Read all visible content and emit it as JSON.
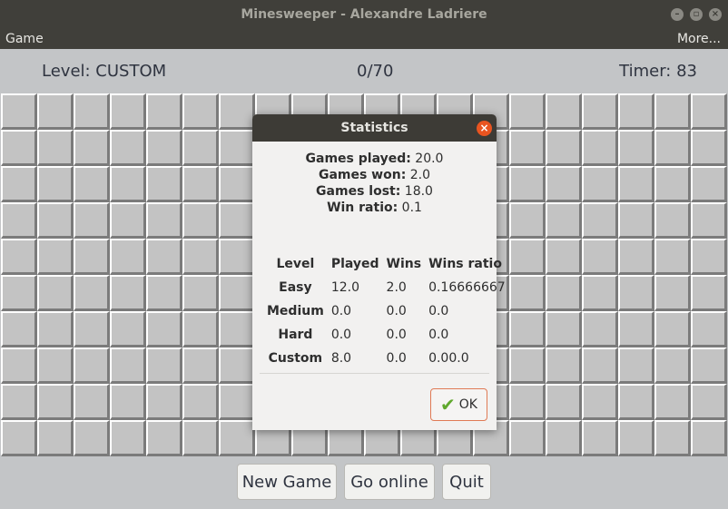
{
  "window": {
    "title": "Minesweeper - Alexandre Ladriere"
  },
  "menu": {
    "game": "Game",
    "more": "More..."
  },
  "status": {
    "level": "Level: CUSTOM",
    "progress": "0/70",
    "timer": "Timer: 83"
  },
  "buttons": {
    "new_game": "New Game",
    "go_online": "Go online",
    "quit": "Quit"
  },
  "icons": {
    "close": "close-icon",
    "minimize": "minimize-icon",
    "maximize": "maximize-icon",
    "check": "check-icon"
  },
  "colors": {
    "accent": "#e95420",
    "titlebar": "#403f3a",
    "board": "#c3c5c7"
  },
  "dialog": {
    "title": "Statistics",
    "summary": [
      {
        "label": "Games played:",
        "value": "20.0"
      },
      {
        "label": "Games won:",
        "value": "2.0"
      },
      {
        "label": "Games lost:",
        "value": "18.0"
      },
      {
        "label": "Win ratio:",
        "value": "0.1"
      }
    ],
    "table": {
      "headers": [
        "Level",
        "Played",
        "Wins",
        "Wins ratio"
      ],
      "rows": [
        [
          "Easy",
          "12.0",
          "2.0",
          "0.16666667"
        ],
        [
          "Medium",
          "0.0",
          "0.0",
          "0.0"
        ],
        [
          "Hard",
          "0.0",
          "0.0",
          "0.0"
        ],
        [
          "Custom",
          "8.0",
          "0.0",
          "0.00.0"
        ]
      ]
    },
    "ok_label": "OK"
  }
}
